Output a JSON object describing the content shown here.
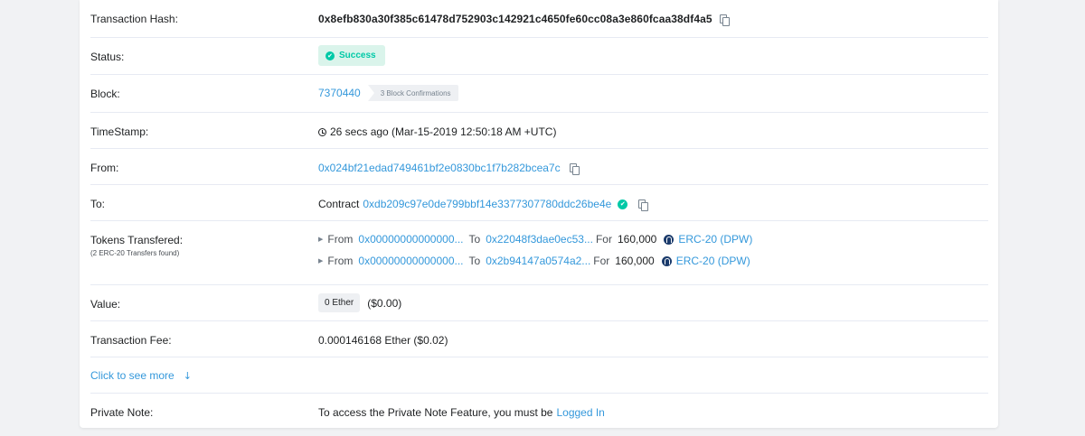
{
  "tx": {
    "hash_label": "Transaction Hash:",
    "hash": "0x8efb830a30f385c61478d752903c142921c4650fe60cc08a3e860fcaa38df4a5",
    "status_label": "Status:",
    "status": "Success",
    "block_label": "Block:",
    "block": "7370440",
    "confirmations": "3 Block Confirmations",
    "timestamp_label": "TimeStamp:",
    "timestamp": "26 secs ago (Mar-15-2019 12:50:18 AM +UTC)",
    "from_label": "From:",
    "from": "0x024bf21edad749461bf2e0830bc1f7b282bcea7c",
    "to_label": "To:",
    "to_prefix": "Contract",
    "to": "0xdb209c97e0de799bbf14e3377307780ddc26be4e",
    "tokens_label": "Tokens Transfered:",
    "tokens_sublabel": "(2 ERC-20 Transfers found)",
    "transfers": [
      {
        "from_word": "From",
        "from": "0x00000000000000...",
        "to_word": "To",
        "to": "0x22048f3dae0ec53...",
        "for_word": "For",
        "amount": "160,000",
        "token": "ERC-20 (DPW)"
      },
      {
        "from_word": "From",
        "from": "0x00000000000000...",
        "to_word": "To",
        "to": "0x2b94147a0574a2...",
        "for_word": "For",
        "amount": "160,000",
        "token": "ERC-20 (DPW)"
      }
    ],
    "value_label": "Value:",
    "value_ether": "0 Ether",
    "value_usd": "($0.00)",
    "fee_label": "Transaction Fee:",
    "fee": "0.000146168 Ether ($0.02)",
    "more_label": "Click to see more",
    "note_label": "Private Note:",
    "note_text": "To access the Private Note Feature, you must be",
    "note_link": "Logged In"
  },
  "colors": {
    "link": "#3498db",
    "success": "#00c9a7",
    "success_bg": "#daf4eb",
    "background": "#f1f2f4"
  },
  "icons": [
    "copy-icon",
    "check-circle-icon",
    "clock-icon",
    "verified-icon",
    "caret-right-icon",
    "token-icon",
    "arrow-down-icon"
  ]
}
